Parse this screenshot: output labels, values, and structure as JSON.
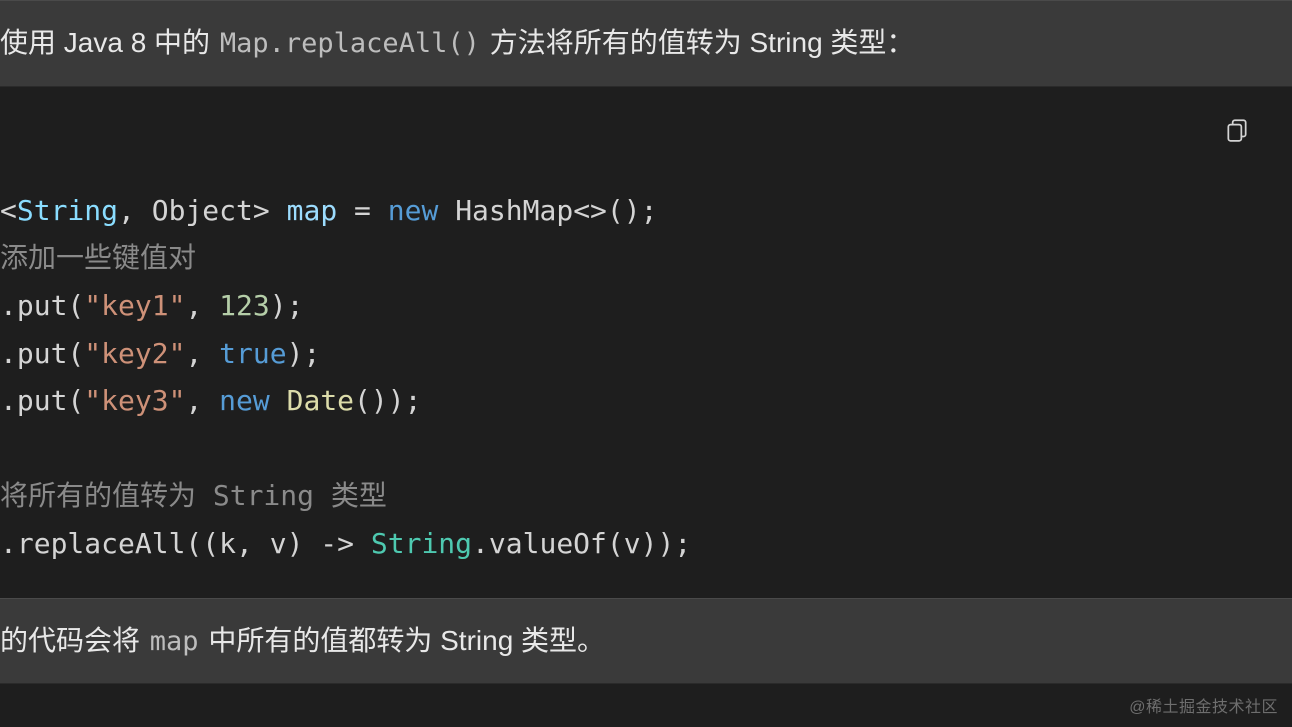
{
  "header": {
    "part1": "使用 Java 8 中的 ",
    "code": "Map.replaceAll()",
    "part2": " 方法将所有的值转为 String 类型："
  },
  "footer": {
    "part1": "的代码会将 ",
    "code": "map",
    "part2": " 中所有的值都转为 String 类型。"
  },
  "icons": {
    "copy": "copy-icon"
  },
  "code": {
    "l1": {
      "a": "<",
      "b": "String",
      "c": ",",
      "d": " Object",
      "e": "> ",
      "f": "map",
      "g": " = ",
      "h": "new",
      "i": " HashMap<>();"
    },
    "l2": "添加一些键值对",
    "l3": {
      "a": ".put(",
      "b": "\"key1\"",
      "c": ", ",
      "d": "123",
      "e": ");"
    },
    "l4": {
      "a": ".put(",
      "b": "\"key2\"",
      "c": ", ",
      "d": "true",
      "e": ");"
    },
    "l5": {
      "a": ".put(",
      "b": "\"key3\"",
      "c": ", ",
      "d": "new",
      "e": " ",
      "f": "Date",
      "g": "());"
    },
    "l6": "",
    "l7": "将所有的值转为 String 类型",
    "l8": {
      "a": ".replaceAll((k, v) -> ",
      "b": "String",
      "c": ".valueOf(v));"
    }
  },
  "watermark": "@稀土掘金技术社区"
}
